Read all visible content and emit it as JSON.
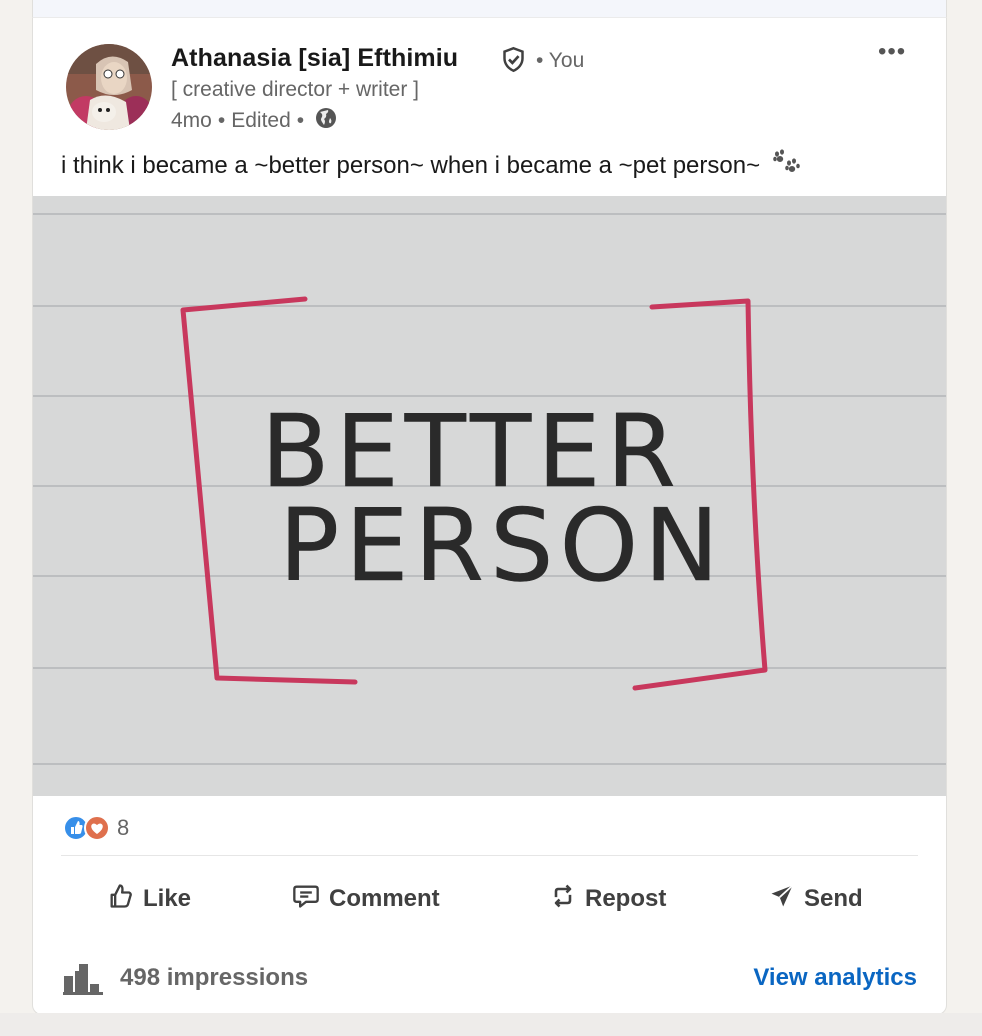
{
  "post": {
    "author_name": "Athanasia [sia] Efthimiu",
    "you_label": "• You",
    "headline": "[ creative director + writer ]",
    "time": "4mo",
    "sep1": "•",
    "edited": "Edited",
    "sep2": "•",
    "text": "i think i became a ~better person~ when i became a ~pet person~",
    "more_label": "•••",
    "image": {
      "line1": "BETTER",
      "line2": "PERSON"
    }
  },
  "reactions": {
    "count": "8",
    "types": [
      "like",
      "love"
    ]
  },
  "actions": {
    "like": "Like",
    "comment": "Comment",
    "repost": "Repost",
    "send": "Send"
  },
  "analytics": {
    "impressions": "498 impressions",
    "view_label": "View analytics"
  },
  "colors": {
    "link_blue": "#0a66c2",
    "text_dark": "#191919",
    "text_muted": "#666666",
    "marker_red": "#c8385d"
  }
}
